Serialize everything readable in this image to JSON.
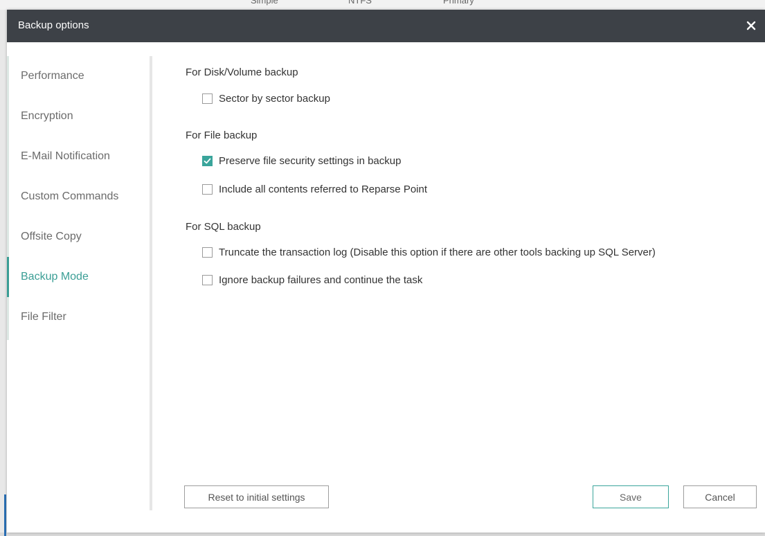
{
  "background": {
    "strip_texts": [
      "Simple",
      "NTFS",
      "Primary"
    ]
  },
  "dialog": {
    "title": "Backup options",
    "close_label": "×"
  },
  "sidebar": {
    "items": [
      {
        "label": "Performance",
        "active": false
      },
      {
        "label": "Encryption",
        "active": false
      },
      {
        "label": "E-Mail Notification",
        "active": false
      },
      {
        "label": "Custom Commands",
        "active": false
      },
      {
        "label": "Offsite Copy",
        "active": false
      },
      {
        "label": "Backup Mode",
        "active": true
      },
      {
        "label": "File Filter",
        "active": false
      }
    ]
  },
  "sections": [
    {
      "title": "For Disk/Volume backup",
      "options": [
        {
          "label": "Sector by sector backup",
          "checked": false
        }
      ]
    },
    {
      "title": "For File backup",
      "options": [
        {
          "label": "Preserve file security settings in backup",
          "checked": true
        },
        {
          "label": "Include all contents referred to Reparse Point",
          "checked": false
        }
      ]
    },
    {
      "title": "For SQL backup",
      "options": [
        {
          "label": "Truncate the transaction log (Disable this option if there are other tools backing up SQL Server)",
          "checked": false
        },
        {
          "label": "Ignore backup failures and continue the task",
          "checked": false
        }
      ]
    }
  ],
  "buttons": {
    "reset_label": "Reset to initial settings",
    "save_label": "Save",
    "cancel_label": "Cancel"
  },
  "colors": {
    "titlebar": "#3d4147",
    "accent": "#3aa59b",
    "active_nav": "#3a9e95"
  }
}
